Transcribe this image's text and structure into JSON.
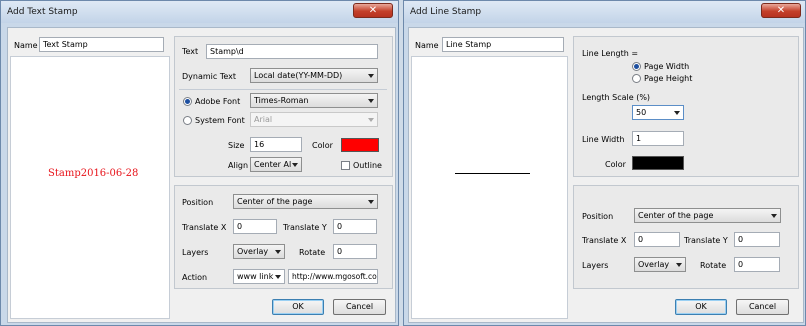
{
  "text_dialog": {
    "title": "Add Text Stamp",
    "close_glyph": "✕",
    "name_label": "Name",
    "name_value": "Text Stamp",
    "preview_text": "Stamp2016-06-28",
    "text_label": "Text",
    "text_value": "Stamp\\d",
    "dynamic_label": "Dynamic Text",
    "dynamic_value": "Local date(YY-MM-DD)",
    "adobe_font_label": "Adobe Font",
    "adobe_font_value": "Times-Roman",
    "system_font_label": "System Font",
    "system_font_value": "Arial",
    "size_label": "Size",
    "size_value": "16",
    "color_label": "Color",
    "color_value": "#ff0000",
    "align_label": "Align",
    "align_value": "Center Al",
    "outline_label": "Outline",
    "position_label": "Position",
    "position_value": "Center of the page",
    "translate_x_label": "Translate X",
    "translate_x_value": "0",
    "translate_y_label": "Translate Y",
    "translate_y_value": "0",
    "layers_label": "Layers",
    "layers_value": "Overlay",
    "rotate_label": "Rotate",
    "rotate_value": "0",
    "action_label": "Action",
    "action_value": "www link",
    "url_value": "http://www.mgosoft.co",
    "ok_label": "OK",
    "cancel_label": "Cancel"
  },
  "line_dialog": {
    "title": "Add Line Stamp",
    "close_glyph": "✕",
    "name_label": "Name",
    "name_value": "Line Stamp",
    "line_length_label": "Line Length =",
    "page_width_label": "Page Width",
    "page_height_label": "Page Height",
    "scale_label": "Length Scale (%)",
    "scale_value": "50",
    "line_width_label": "Line Width",
    "line_width_value": "1",
    "color_label": "Color",
    "color_value": "#000000",
    "position_label": "Position",
    "position_value": "Center of the page",
    "translate_x_label": "Translate X",
    "translate_x_value": "0",
    "translate_y_label": "Translate Y",
    "translate_y_value": "0",
    "layers_label": "Layers",
    "layers_value": "Overlay",
    "rotate_label": "Rotate",
    "rotate_value": "0",
    "ok_label": "OK",
    "cancel_label": "Cancel"
  },
  "colors": {
    "window_frame": "#c9d8e9",
    "close_button": "#c4402a",
    "preview_text": "#e8131a",
    "text_color": "#ff0000",
    "line_color": "#000000"
  }
}
